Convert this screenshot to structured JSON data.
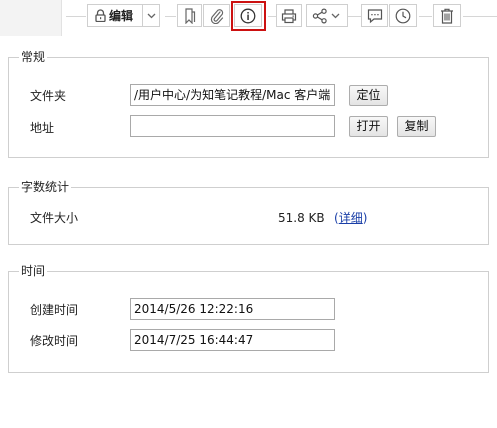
{
  "toolbar": {
    "edit_label": "编辑",
    "icons": [
      "lock-icon",
      "chevron-down-icon",
      "bookmark-icon",
      "attachment-icon",
      "info-icon",
      "print-icon",
      "share-icon",
      "comment-icon",
      "clock-icon",
      "trash-icon"
    ],
    "highlight_color": "#cc1111"
  },
  "general": {
    "title": "常规",
    "folder_label": "文件夹",
    "folder_value": "/用户中心/为知笔记教程/Mac 客户端",
    "locate_label": "定位",
    "address_label": "地址",
    "address_value": "",
    "open_label": "打开",
    "copy_label": "复制"
  },
  "stats": {
    "title": "字数统计",
    "size_label": "文件大小",
    "size_value": "51.8 KB",
    "detail_open": "(",
    "detail_label": "详细",
    "detail_close": ")"
  },
  "time": {
    "title": "时间",
    "created_label": "创建时间",
    "created_value": "2014/5/26 12:22:16",
    "modified_label": "修改时间",
    "modified_value": "2014/7/25 16:44:47"
  }
}
